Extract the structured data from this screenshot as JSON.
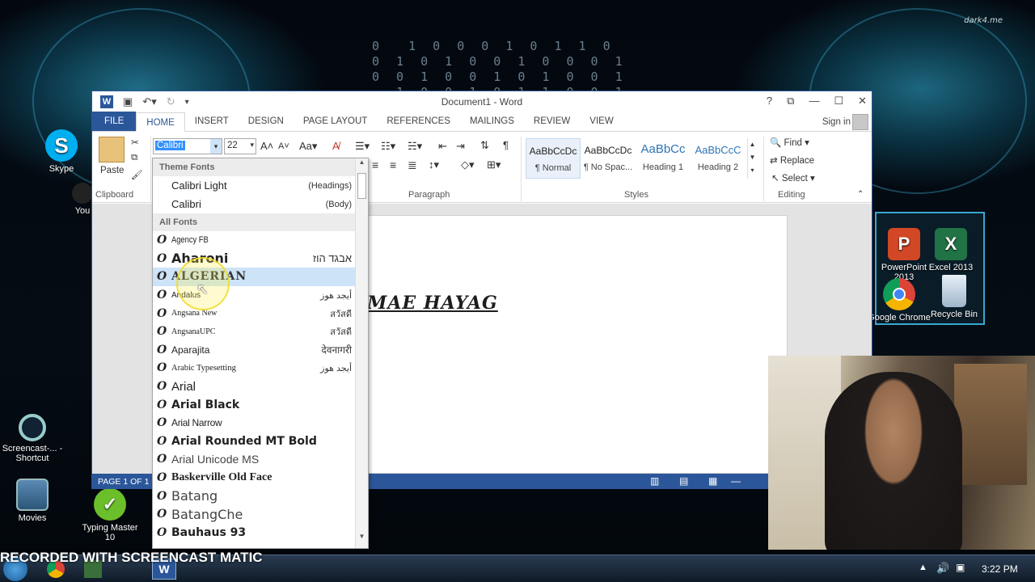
{
  "desktop": {
    "icons": [
      {
        "label": "Skype"
      },
      {
        "label": "You"
      },
      {
        "label": "Screencast-... - Shortcut"
      },
      {
        "label": "Movies"
      },
      {
        "label": "Typing Master 10"
      },
      {
        "label": "PowerPoint 2013"
      },
      {
        "label": "Excel 2013"
      },
      {
        "label": "Google Chrome"
      },
      {
        "label": "Recycle Bin"
      }
    ],
    "watermark": "RECORDED WITH SCREENCAST MATIC",
    "corner_logo": "dark4.me"
  },
  "window": {
    "title": "Document1 - Word",
    "tabs": [
      "FILE",
      "HOME",
      "INSERT",
      "DESIGN",
      "PAGE LAYOUT",
      "REFERENCES",
      "MAILINGS",
      "REVIEW",
      "VIEW"
    ],
    "active_tab": "HOME",
    "sign_in": "Sign in",
    "help": "?"
  },
  "ribbon": {
    "font_name": "Calibri",
    "font_size": "22",
    "paste_label": "Paste",
    "clipboard_label": "Clipboard",
    "paragraph_label": "Paragraph",
    "styles_label": "Styles",
    "editing_label": "Editing",
    "styles": [
      {
        "sample": "AaBbCcDc",
        "name": "¶ Normal"
      },
      {
        "sample": "AaBbCcDc",
        "name": "¶ No Spac..."
      },
      {
        "sample": "AaBbCc",
        "name": "Heading 1"
      },
      {
        "sample": "AaBbCcC",
        "name": "Heading 2"
      }
    ],
    "find": "Find",
    "replace": "Replace",
    "select": "Select"
  },
  "document": {
    "text": "MAE HAYAG"
  },
  "status": {
    "page": "PAGE 1 OF 1"
  },
  "font_dropdown": {
    "theme_header": "Theme Fonts",
    "theme_fonts": [
      {
        "name": "Calibri Light",
        "role": "(Headings)"
      },
      {
        "name": "Calibri",
        "role": "(Body)"
      }
    ],
    "all_header": "All Fonts",
    "fonts": [
      {
        "name": "Agency FB",
        "sample": ""
      },
      {
        "name": "Aharoni",
        "sample": "אבגד הוז"
      },
      {
        "name": "ALGERIAN",
        "sample": ""
      },
      {
        "name": "Andalus",
        "sample": "أيجد هوز"
      },
      {
        "name": "Angsana New",
        "sample": "สวัสดี"
      },
      {
        "name": "AngsanaUPC",
        "sample": "สวัสดี"
      },
      {
        "name": "Aparajita",
        "sample": "देवनागरी"
      },
      {
        "name": "Arabic Typesetting",
        "sample": "أيجد هوز"
      },
      {
        "name": "Arial",
        "sample": ""
      },
      {
        "name": "Arial Black",
        "sample": ""
      },
      {
        "name": "Arial Narrow",
        "sample": ""
      },
      {
        "name": "Arial Rounded MT Bold",
        "sample": ""
      },
      {
        "name": "Arial Unicode MS",
        "sample": ""
      },
      {
        "name": "Baskerville Old Face",
        "sample": ""
      },
      {
        "name": "Batang",
        "sample": ""
      },
      {
        "name": "BatangChe",
        "sample": ""
      },
      {
        "name": "Bauhaus 93",
        "sample": ""
      }
    ],
    "highlighted": "ALGERIAN"
  },
  "taskbar": {
    "time": "3:22 PM"
  }
}
